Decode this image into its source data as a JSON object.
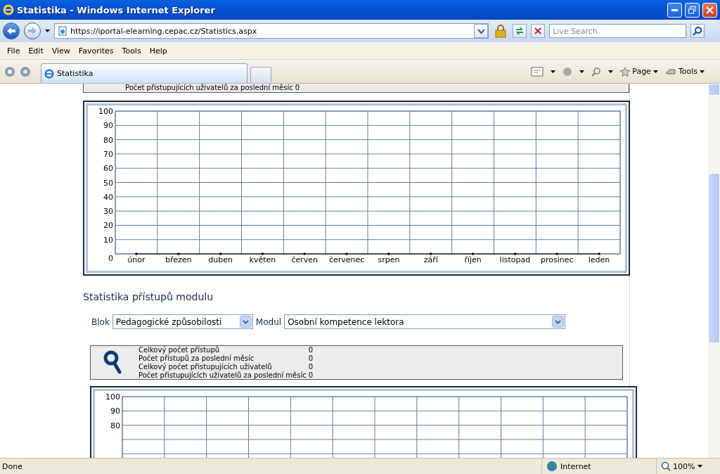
{
  "window": {
    "title": "Statistika - Windows Internet Explorer"
  },
  "address_bar": {
    "url": "https://iportal-elearning.cepac.cz/Statistics.aspx"
  },
  "search": {
    "placeholder": "Live Search"
  },
  "menu": [
    "File",
    "Edit",
    "View",
    "Favorites",
    "Tools",
    "Help"
  ],
  "tabs": [
    {
      "label": "Statistika",
      "selected": true
    }
  ],
  "command_bar": [
    "Page",
    "Tools"
  ],
  "page": {
    "top_stats": {
      "label": "Počet přistupujících uživatelů za poslední měsíc",
      "value": "0"
    },
    "chart1": {
      "chart_data": {
        "type": "line",
        "categories": [
          "únor",
          "březen",
          "duben",
          "květen",
          "červen",
          "červenec",
          "srpen",
          "září",
          "říjen",
          "listopad",
          "prosinec",
          "leden"
        ],
        "series": [
          {
            "color": "#000000",
            "values": [
              0,
              0,
              0,
              0,
              0,
              0,
              0,
              0,
              0,
              0,
              0,
              0
            ]
          }
        ],
        "ylim": [
          0,
          100
        ],
        "yticks": [
          0,
          10,
          20,
          30,
          40,
          50,
          60,
          70,
          80,
          90,
          100
        ],
        "grid": true
      }
    },
    "section_title": "Statistika přístupů modulu",
    "filters": [
      {
        "label": "Blok",
        "value": "Pedagogické způsobilosti"
      },
      {
        "label": "Modul",
        "value": "Osobní kompetence lektora"
      }
    ],
    "stats": [
      {
        "label": "Celkový počet přístupů",
        "value": "0"
      },
      {
        "label": "Počet přístupů za poslední měsíc",
        "value": "0"
      },
      {
        "label": "Celkový počet přistupujících uživatelů",
        "value": "0"
      },
      {
        "label": "Počet přistupujících uživatelů za poslední měsíc",
        "value": "0"
      }
    ],
    "chart2": {
      "y_labels": [
        "100",
        "90",
        "80"
      ]
    }
  },
  "status_bar": {
    "text": "Done",
    "zone": "Internet",
    "zoom": "100%"
  }
}
